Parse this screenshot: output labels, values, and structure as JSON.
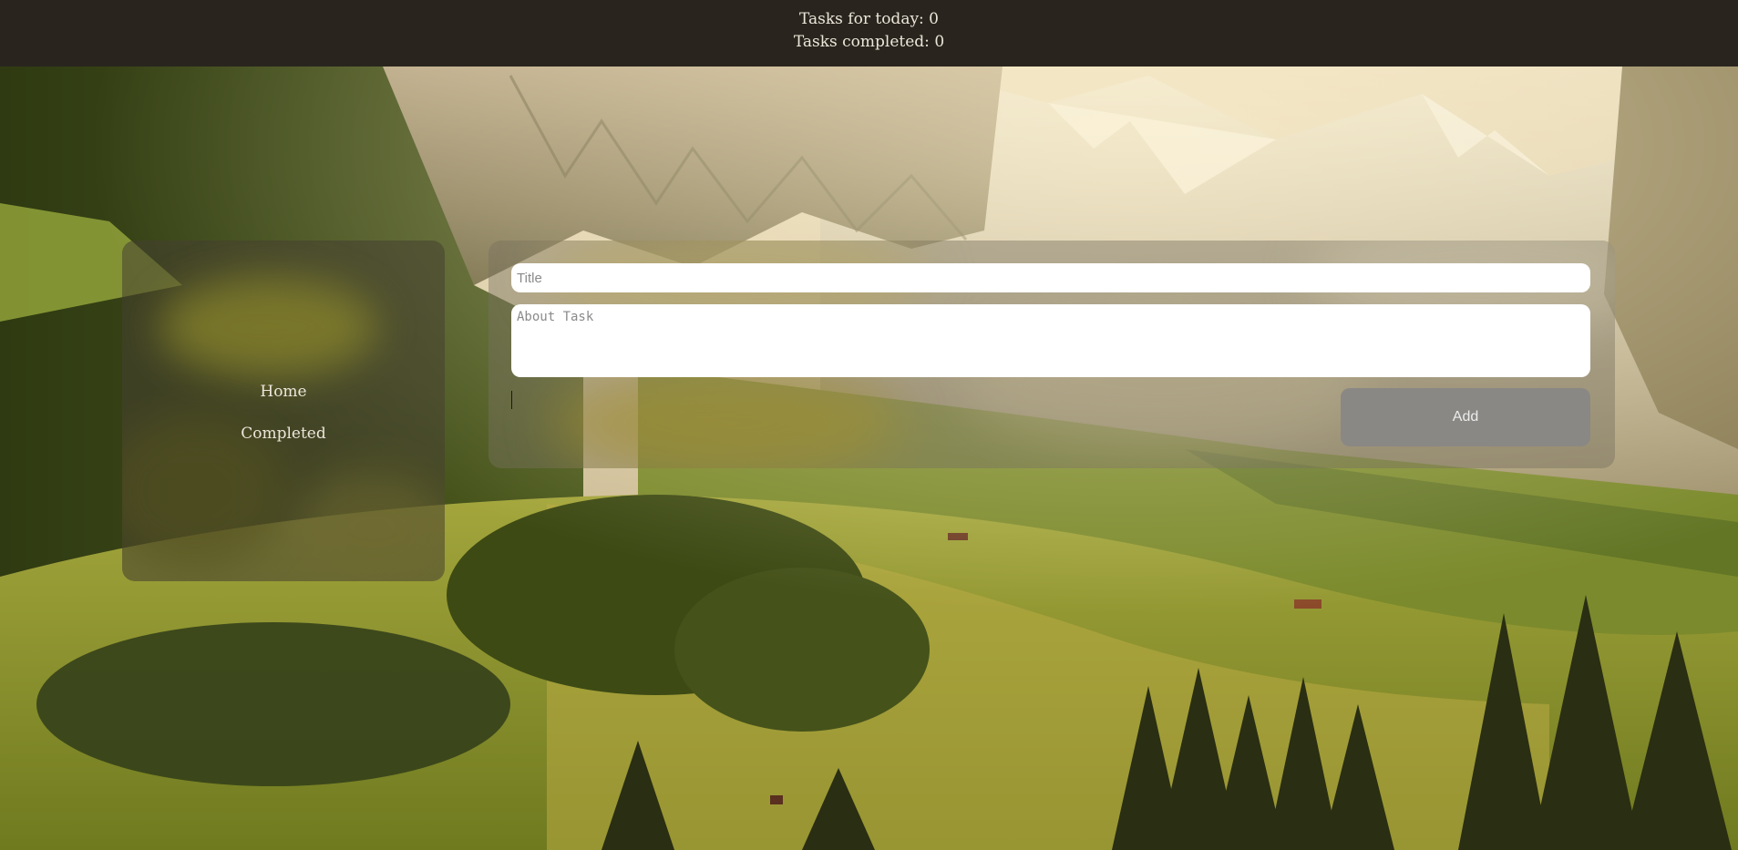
{
  "header": {
    "tasks_today_label": "Tasks for today: 0",
    "tasks_completed_label": "Tasks completed: 0"
  },
  "sidebar": {
    "items": [
      {
        "label": "Home"
      },
      {
        "label": "Completed"
      }
    ]
  },
  "form": {
    "title_placeholder": "Title",
    "title_value": "",
    "about_placeholder": "About Task",
    "about_value": "",
    "add_label": "Add"
  },
  "colors": {
    "header_bg": "#29251e",
    "header_text": "#ece6da",
    "button_bg": "#8a8884",
    "button_text": "#ececec"
  },
  "background": {
    "description_icon": "mountain-landscape-image"
  }
}
